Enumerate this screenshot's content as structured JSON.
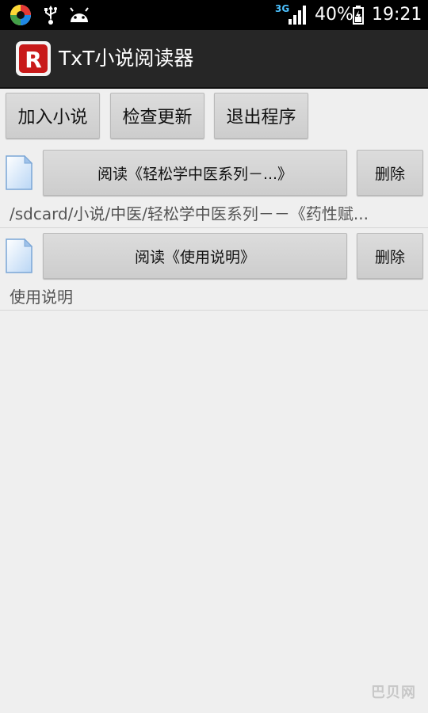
{
  "status_bar": {
    "network": "3G",
    "battery": "40%",
    "time": "19:21",
    "icons": [
      "app-ball-icon",
      "usb-icon",
      "android-icon",
      "signal-icon",
      "battery-icon"
    ]
  },
  "app": {
    "title": "TxT小说阅读器",
    "logo_letter": "R",
    "logo_color": "#c81a1a"
  },
  "toolbar": {
    "add_label": "加入小说",
    "check_label": "检查更新",
    "exit_label": "退出程序"
  },
  "books": [
    {
      "read_label": "阅读《轻松学中医系列－...》",
      "delete_label": "删除",
      "path": "/sdcard/小说/中医/轻松学中医系列－－《药性赋..."
    },
    {
      "read_label": "阅读《使用说明》",
      "delete_label": "删除",
      "path": "使用说明"
    }
  ],
  "watermark": "巴贝网"
}
